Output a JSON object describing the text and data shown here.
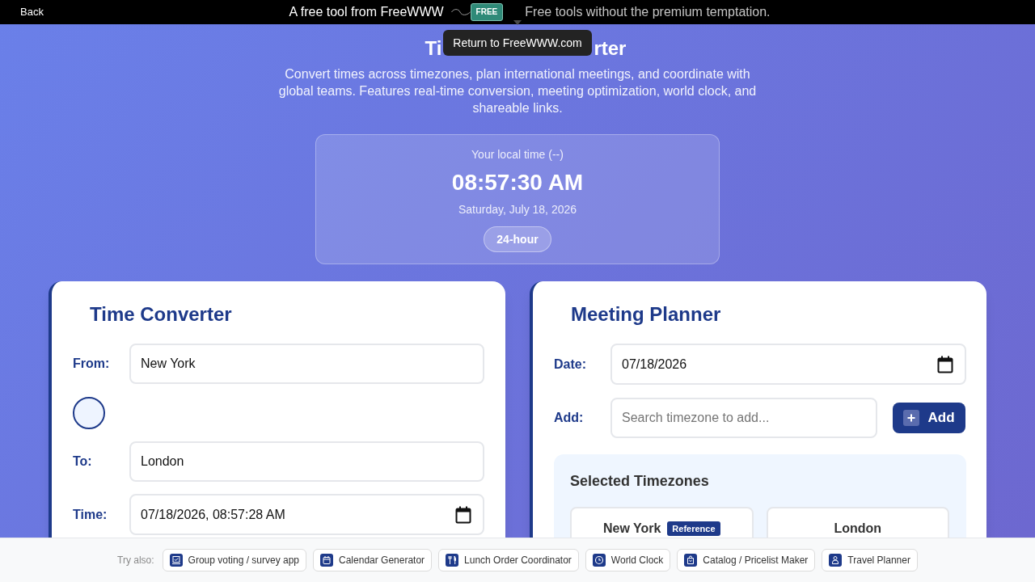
{
  "top_bar": {
    "back_link": "Back",
    "tagline": "A free tool from FreeWWW",
    "logo_label": "FREE",
    "slogan": "Free tools without the premium temptation."
  },
  "tooltip": "Return to FreeWWW.com",
  "header": {
    "title_parts": [
      "Ti",
      "rter"
    ],
    "description": "Convert times across timezones, plan international meetings, and coordinate with global teams. Features real-time conversion, meeting optimization, world clock, and shareable links."
  },
  "local_time": {
    "label": "Your local time (--)",
    "time": "08:57:30 AM",
    "date": "Saturday, July 18, 2026",
    "format_button": "24-hour"
  },
  "time_converter": {
    "title": "Time Converter",
    "rows": [
      {
        "kind": "text",
        "label": "From:",
        "value": "New York"
      },
      {
        "kind": "swap"
      },
      {
        "kind": "text",
        "label": "To:",
        "value": "London"
      },
      {
        "kind": "datetime",
        "label": "Time:",
        "value": "07/18/2026, 08:57:28 AM"
      }
    ]
  },
  "meeting_planner": {
    "title": "Meeting Planner",
    "date_field": {
      "label": "Date:",
      "value": "07/18/2026"
    },
    "add_field": {
      "label": "Add:",
      "placeholder": "Search timezone to add...",
      "button": "Add"
    },
    "selected_timezones": {
      "title": "Selected Timezones",
      "zones": [
        {
          "name": "New York",
          "badge": "Reference"
        },
        {
          "name": "London"
        }
      ]
    }
  },
  "try_also": {
    "label": "Try also:",
    "links": [
      "Group voting / survey app",
      "Calendar Generator",
      "Lunch Order Coordinator",
      "World Clock",
      "Catalog / Pricelist Maker",
      "Travel Planner"
    ]
  }
}
